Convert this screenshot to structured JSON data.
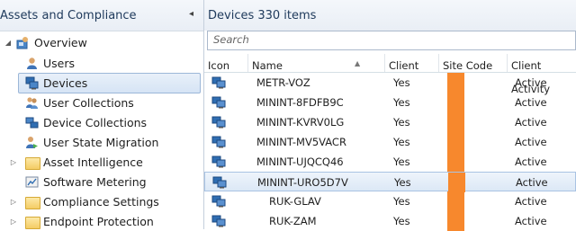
{
  "nav": {
    "title": "Assets and Compliance",
    "collapse_glyph": "◂",
    "items": [
      {
        "label": "Overview",
        "icon": "overview-icon",
        "expander": "◢"
      },
      {
        "label": "Users",
        "icon": "users-icon",
        "expander": ""
      },
      {
        "label": "Devices",
        "icon": "devices-icon",
        "expander": "",
        "selected": true
      },
      {
        "label": "User Collections",
        "icon": "user-collections-icon",
        "expander": ""
      },
      {
        "label": "Device Collections",
        "icon": "device-collections-icon",
        "expander": ""
      },
      {
        "label": "User State Migration",
        "icon": "user-state-migration-icon",
        "expander": ""
      },
      {
        "label": "Asset Intelligence",
        "icon": "folder-icon",
        "expander": "▷"
      },
      {
        "label": "Software Metering",
        "icon": "software-metering-icon",
        "expander": ""
      },
      {
        "label": "Compliance Settings",
        "icon": "folder-icon",
        "expander": "▷"
      },
      {
        "label": "Endpoint Protection",
        "icon": "folder-icon",
        "expander": "▷"
      }
    ]
  },
  "main": {
    "title": "Devices 330 items",
    "search_placeholder": "Search",
    "columns": [
      "Icon",
      "Name",
      "Client",
      "Site Code",
      "Client Activity"
    ],
    "sort_glyph": "▲",
    "rows": [
      {
        "name": "METR-VOZ",
        "client": "Yes",
        "activity": "Active"
      },
      {
        "name": "MININT-8FDFB9C",
        "client": "Yes",
        "activity": "Active"
      },
      {
        "name": "MININT-KVRV0LG",
        "client": "Yes",
        "activity": "Active"
      },
      {
        "name": "MININT-MV5VACR",
        "client": "Yes",
        "activity": "Active"
      },
      {
        "name": "MININT-UJQCQ46",
        "client": "Yes",
        "activity": "Active"
      },
      {
        "name": "MININT-URO5D7V",
        "client": "Yes",
        "activity": "Active",
        "selected": true
      },
      {
        "name": "RUK-GLAV",
        "client": "Yes",
        "activity": "Active"
      },
      {
        "name": "RUK-ZAM",
        "client": "Yes",
        "activity": "Active"
      }
    ],
    "site_code_redaction_color": "#f7882d"
  }
}
